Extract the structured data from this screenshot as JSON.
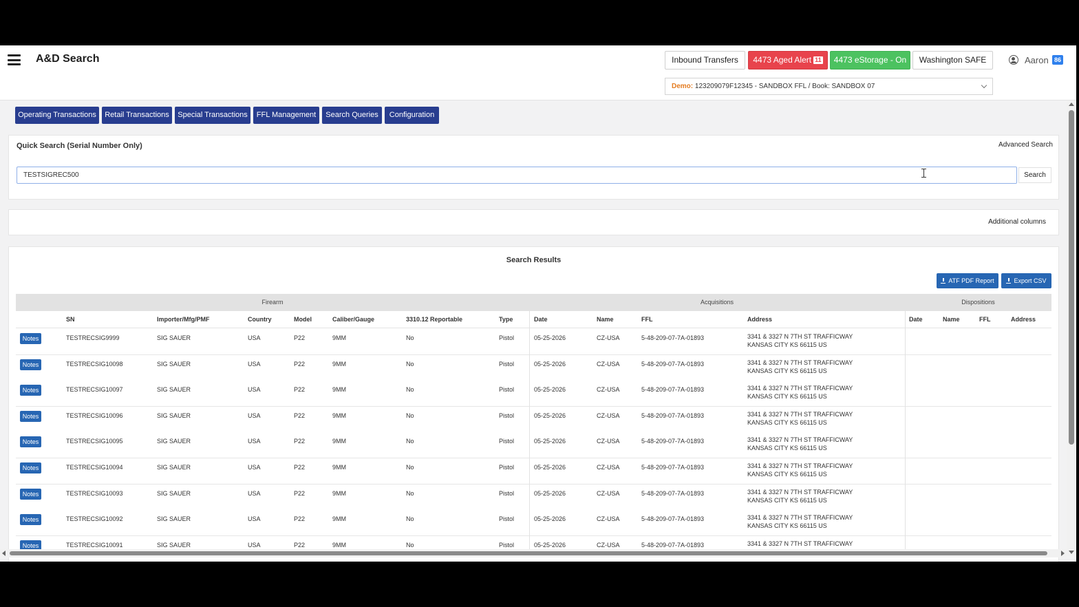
{
  "header": {
    "title": "A&D Search",
    "inbound_label": "Inbound Transfers",
    "aged_label": "4473 Aged Alert",
    "aged_count": "11",
    "estorage_label": "4473 eStorage - On",
    "state_label": "Washington SAFE",
    "user_name": "Aaron",
    "user_badge": "86",
    "ffl_prefix": "Demo:",
    "ffl_value": "123209079F12345 - SANDBOX FFL / Book: SANDBOX 07"
  },
  "nav": [
    "Operating Transactions",
    "Retail Transactions",
    "Special Transactions",
    "FFL Management",
    "Search Queries",
    "Configuration"
  ],
  "quick_search": {
    "title": "Quick Search (Serial Number Only)",
    "advanced_label": "Advanced Search",
    "value": "TESTSIGREC500",
    "button_label": "Search"
  },
  "additional_columns_label": "Additional columns",
  "results": {
    "title": "Search Results",
    "atf_label": "ATF PDF Report",
    "export_label": "Export CSV",
    "groups": [
      "Firearm",
      "Acquisitions",
      "Dispositions"
    ],
    "columns": [
      "SN",
      "Importer/Mfg/PMF",
      "Country",
      "Model",
      "Caliber/Gauge",
      "3310.12 Reportable",
      "Type",
      "Date",
      "Name",
      "FFL",
      "Address",
      "Date",
      "Name",
      "FFL",
      "Address"
    ],
    "notes_label": "Notes",
    "rows": [
      {
        "sn": "TESTRECSIG9999",
        "mfg": "SIG SAUER",
        "country": "USA",
        "model": "P22",
        "caliber": "9MM",
        "reportable": "No",
        "type": "Pistol",
        "acq_date": "05-25-2026",
        "acq_name": "CZ-USA",
        "acq_ffl": "5-48-209-07-7A-01893",
        "addr1": "3341 & 3327 N 7TH ST TRAFFICWAY",
        "addr2": "KANSAS CITY KS 66115 US"
      },
      {
        "sn": "TESTRECSIG10098",
        "mfg": "SIG SAUER",
        "country": "USA",
        "model": "P22",
        "caliber": "9MM",
        "reportable": "No",
        "type": "Pistol",
        "acq_date": "05-25-2026",
        "acq_name": "CZ-USA",
        "acq_ffl": "5-48-209-07-7A-01893",
        "addr1": "3341 & 3327 N 7TH ST TRAFFICWAY",
        "addr2": "KANSAS CITY KS 66115 US"
      },
      {
        "sn": "TESTRECSIG10097",
        "mfg": "SIG SAUER",
        "country": "USA",
        "model": "P22",
        "caliber": "9MM",
        "reportable": "No",
        "type": "Pistol",
        "acq_date": "05-25-2026",
        "acq_name": "CZ-USA",
        "acq_ffl": "5-48-209-07-7A-01893",
        "addr1": "3341 & 3327 N 7TH ST TRAFFICWAY",
        "addr2": "KANSAS CITY KS 66115 US"
      },
      {
        "sn": "TESTRECSIG10096",
        "mfg": "SIG SAUER",
        "country": "USA",
        "model": "P22",
        "caliber": "9MM",
        "reportable": "No",
        "type": "Pistol",
        "acq_date": "05-25-2026",
        "acq_name": "CZ-USA",
        "acq_ffl": "5-48-209-07-7A-01893",
        "addr1": "3341 & 3327 N 7TH ST TRAFFICWAY",
        "addr2": "KANSAS CITY KS 66115 US"
      },
      {
        "sn": "TESTRECSIG10095",
        "mfg": "SIG SAUER",
        "country": "USA",
        "model": "P22",
        "caliber": "9MM",
        "reportable": "No",
        "type": "Pistol",
        "acq_date": "05-25-2026",
        "acq_name": "CZ-USA",
        "acq_ffl": "5-48-209-07-7A-01893",
        "addr1": "3341 & 3327 N 7TH ST TRAFFICWAY",
        "addr2": "KANSAS CITY KS 66115 US"
      },
      {
        "sn": "TESTRECSIG10094",
        "mfg": "SIG SAUER",
        "country": "USA",
        "model": "P22",
        "caliber": "9MM",
        "reportable": "No",
        "type": "Pistol",
        "acq_date": "05-25-2026",
        "acq_name": "CZ-USA",
        "acq_ffl": "5-48-209-07-7A-01893",
        "addr1": "3341 & 3327 N 7TH ST TRAFFICWAY",
        "addr2": "KANSAS CITY KS 66115 US"
      },
      {
        "sn": "TESTRECSIG10093",
        "mfg": "SIG SAUER",
        "country": "USA",
        "model": "P22",
        "caliber": "9MM",
        "reportable": "No",
        "type": "Pistol",
        "acq_date": "05-25-2026",
        "acq_name": "CZ-USA",
        "acq_ffl": "5-48-209-07-7A-01893",
        "addr1": "3341 & 3327 N 7TH ST TRAFFICWAY",
        "addr2": "KANSAS CITY KS 66115 US"
      },
      {
        "sn": "TESTRECSIG10092",
        "mfg": "SIG SAUER",
        "country": "USA",
        "model": "P22",
        "caliber": "9MM",
        "reportable": "No",
        "type": "Pistol",
        "acq_date": "05-25-2026",
        "acq_name": "CZ-USA",
        "acq_ffl": "5-48-209-07-7A-01893",
        "addr1": "3341 & 3327 N 7TH ST TRAFFICWAY",
        "addr2": "KANSAS CITY KS 66115 US"
      },
      {
        "sn": "TESTRECSIG10091",
        "mfg": "SIG SAUER",
        "country": "USA",
        "model": "P22",
        "caliber": "9MM",
        "reportable": "No",
        "type": "Pistol",
        "acq_date": "05-25-2026",
        "acq_name": "CZ-USA",
        "acq_ffl": "5-48-209-07-7A-01893",
        "addr1": "3341 & 3327 N 7TH ST TRAFFICWAY",
        "addr2": ""
      }
    ]
  }
}
